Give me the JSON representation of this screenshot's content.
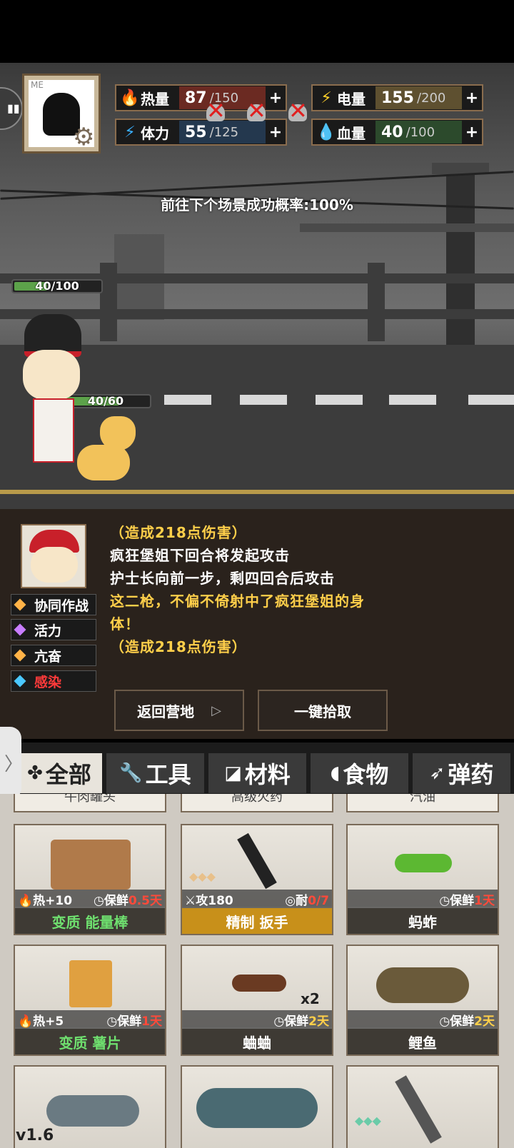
{
  "stats": {
    "heat": {
      "label": "热量",
      "current": "87",
      "max": "/150",
      "plus": "+",
      "fill": 0.58
    },
    "power": {
      "label": "电量",
      "current": "155",
      "max": "/200",
      "plus": "+",
      "fill": 0.775
    },
    "stamina": {
      "label": "体力",
      "current": "55",
      "max": "/125",
      "plus": "+",
      "fill": 0.44
    },
    "blood": {
      "label": "血量",
      "current": "40",
      "max": "/100",
      "plus": "+",
      "fill": 0.4
    }
  },
  "avatar": {
    "tag": "ME"
  },
  "success_rate": "前往下个场景成功概率:100%",
  "player_hp": {
    "text": "40/100",
    "fill": 0.4
  },
  "pet_hp": {
    "text": "40/60",
    "fill": 0.667
  },
  "log": {
    "line1": "（造成218点伤害）",
    "line2": "疯狂堡姐下回合将发起攻击",
    "line3": "护士长向前一步，剩四回合后攻击",
    "line4": "这二枪，不偏不倚射中了疯狂堡姐的身",
    "line5": "体！",
    "line6": "（造成218点伤害）"
  },
  "statuses": [
    {
      "label": "协同作战",
      "color": "#ffb347"
    },
    {
      "label": "活力",
      "color": "#c77dff"
    },
    {
      "label": "亢奋",
      "color": "#ffb347"
    },
    {
      "label": "感染",
      "color": "#4ac8ff"
    }
  ],
  "actions": {
    "return": "返回营地",
    "pickup": "一键拾取"
  },
  "tabs": [
    {
      "label": "全部",
      "icon": "grid-icon"
    },
    {
      "label": "工具",
      "icon": "wrench-icon"
    },
    {
      "label": "材料",
      "icon": "material-icon"
    },
    {
      "label": "食物",
      "icon": "meat-icon"
    },
    {
      "label": "弹药",
      "icon": "bullet-icon"
    }
  ],
  "top_row_names": [
    "牛肉罐头",
    "高级火药",
    "汽油"
  ],
  "items": [
    {
      "name_prefix": "变质",
      "name": "能量棒",
      "left_stat": "热+10",
      "right_stat_label": "保鲜",
      "right_stat_value": "0.5天"
    },
    {
      "name_prefix": "精制",
      "name": "扳手",
      "left_stat": "攻180",
      "right_stat_label": "耐",
      "right_stat_value": "0/7"
    },
    {
      "name_prefix": "",
      "name": "蚂蚱",
      "left_stat": "",
      "right_stat_label": "保鲜",
      "right_stat_value": "1天"
    },
    {
      "name_prefix": "变质",
      "name": "薯片",
      "left_stat": "热+5",
      "right_stat_label": "保鲜",
      "right_stat_value": "1天"
    },
    {
      "name_prefix": "",
      "name": "蛐蛐",
      "left_stat": "",
      "right_stat_label": "保鲜",
      "right_stat_value": "2天",
      "count": "x2"
    },
    {
      "name_prefix": "",
      "name": "鲤鱼",
      "left_stat": "",
      "right_stat_label": "保鲜",
      "right_stat_value": "2天"
    }
  ],
  "version": "v1.6"
}
